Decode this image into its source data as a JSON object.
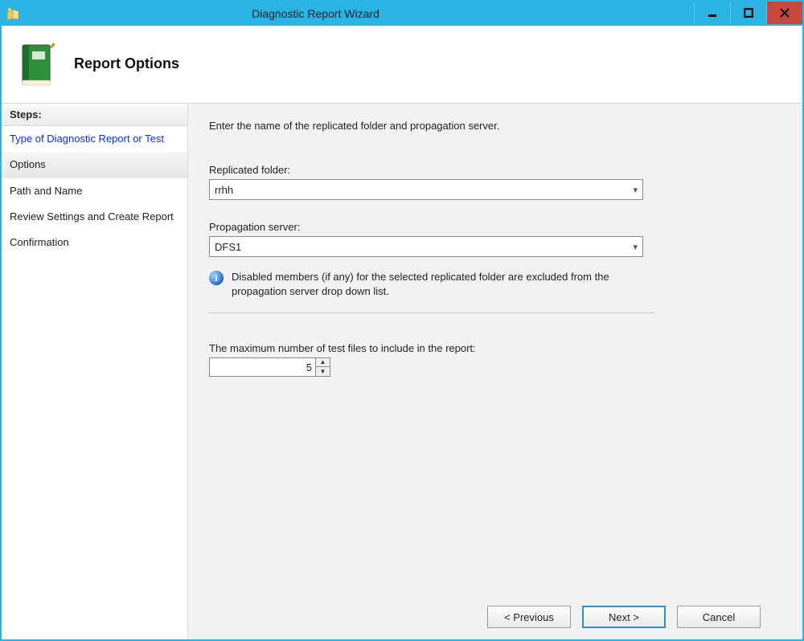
{
  "window": {
    "title": "Diagnostic Report Wizard"
  },
  "header": {
    "title": "Report Options"
  },
  "sidebar": {
    "heading": "Steps:",
    "steps": [
      {
        "label": "Type of Diagnostic Report or Test",
        "state": "link"
      },
      {
        "label": "Options",
        "state": "selected"
      },
      {
        "label": "Path and Name",
        "state": "normal"
      },
      {
        "label": "Review Settings and Create Report",
        "state": "normal"
      },
      {
        "label": "Confirmation",
        "state": "normal"
      }
    ]
  },
  "main": {
    "prompt": "Enter the name of the replicated folder and propagation server.",
    "replicated_folder_label": "Replicated folder:",
    "replicated_folder_value": "rrhh",
    "propagation_server_label": "Propagation server:",
    "propagation_server_value": "DFS1",
    "info_text": "Disabled members (if any) for the selected replicated folder are excluded from the propagation server drop down list.",
    "max_files_label": "The maximum number of test files to include in the report:",
    "max_files_value": "5"
  },
  "buttons": {
    "previous": "< Previous",
    "next": "Next >",
    "cancel": "Cancel"
  }
}
